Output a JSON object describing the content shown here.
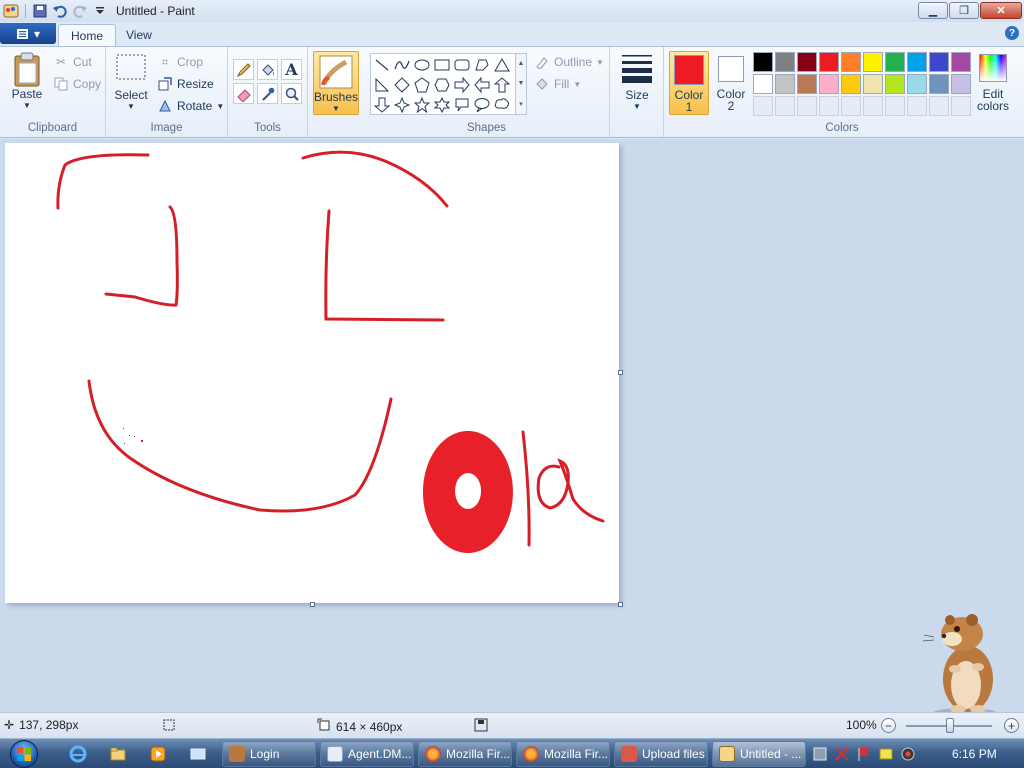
{
  "window": {
    "title": "Untitled - Paint",
    "controls": {
      "minimize": "▁",
      "maximize": "❐",
      "close": "✕"
    }
  },
  "tabs": {
    "app_menu": "▾",
    "home": "Home",
    "view": "View"
  },
  "clipboard": {
    "group_label": "Clipboard",
    "paste": "Paste",
    "cut": "Cut",
    "copy": "Copy"
  },
  "image": {
    "group_label": "Image",
    "select": "Select",
    "crop": "Crop",
    "resize": "Resize",
    "rotate": "Rotate"
  },
  "tools": {
    "group_label": "Tools",
    "text_tool": "A"
  },
  "brushes": {
    "label": "Brushes"
  },
  "shapes": {
    "group_label": "Shapes",
    "outline": "Outline",
    "fill": "Fill",
    "items": [
      "line",
      "curve",
      "oval",
      "rectangle",
      "rounded-rectangle",
      "polygon",
      "triangle",
      "right-triangle",
      "diamond",
      "pentagon",
      "hexagon",
      "right-arrow",
      "left-arrow",
      "up-arrow",
      "down-arrow",
      "four-point-star",
      "five-point-star",
      "six-point-star",
      "rounded-callout",
      "oval-callout",
      "cloud-callout"
    ]
  },
  "size": {
    "label": "Size"
  },
  "colors": {
    "group_label": "Colors",
    "color1_label_a": "Color",
    "color1_label_b": "1",
    "color2_label_a": "Color",
    "color2_label_b": "2",
    "color1": "#ed1c24",
    "color2": "#ffffff",
    "edit_a": "Edit",
    "edit_b": "colors",
    "palette": [
      "#000000",
      "#7f7f7f",
      "#880015",
      "#ed1c24",
      "#ff7f27",
      "#fff200",
      "#22b14c",
      "#00a2e8",
      "#3f48cc",
      "#a349a4",
      "#ffffff",
      "#c3c3c3",
      "#b97a57",
      "#ffaec9",
      "#ffc90e",
      "#efe4b0",
      "#b5e61d",
      "#99d9ea",
      "#7092be",
      "#c8bfe7"
    ]
  },
  "status": {
    "cursor_pos": "137, 298px",
    "canvas_size": "614 × 460px",
    "zoom": "100%"
  },
  "taskbar": {
    "buttons": [
      {
        "label": "Login",
        "icon": "hamster-icon"
      },
      {
        "label": "Agent.DM...",
        "icon": "window-icon"
      },
      {
        "label": "Mozilla Fir...",
        "icon": "firefox-icon"
      },
      {
        "label": "Mozilla Fir...",
        "icon": "firefox-icon"
      },
      {
        "label": "Upload files",
        "icon": "upload-icon"
      },
      {
        "label": "Untitled - ...",
        "icon": "paint-icon"
      }
    ],
    "clock": "6:16 PM"
  }
}
